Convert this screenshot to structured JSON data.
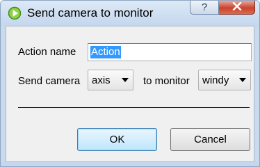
{
  "window": {
    "title": "Send camera to monitor",
    "help_label": "?",
    "icon": "green-play-circle-icon",
    "close_icon": "close-icon"
  },
  "form": {
    "action_name_label": "Action name",
    "action_name_value": "Action",
    "send_camera_label": "Send camera",
    "camera_value": "axis",
    "to_monitor_label": "to monitor",
    "monitor_value": "windy"
  },
  "buttons": {
    "ok_label": "OK",
    "cancel_label": "Cancel"
  },
  "colors": {
    "titlebar": "#c9daee",
    "client_bg": "#f0f0f0",
    "selection": "#3399ff",
    "close_red": "#c9432d"
  }
}
